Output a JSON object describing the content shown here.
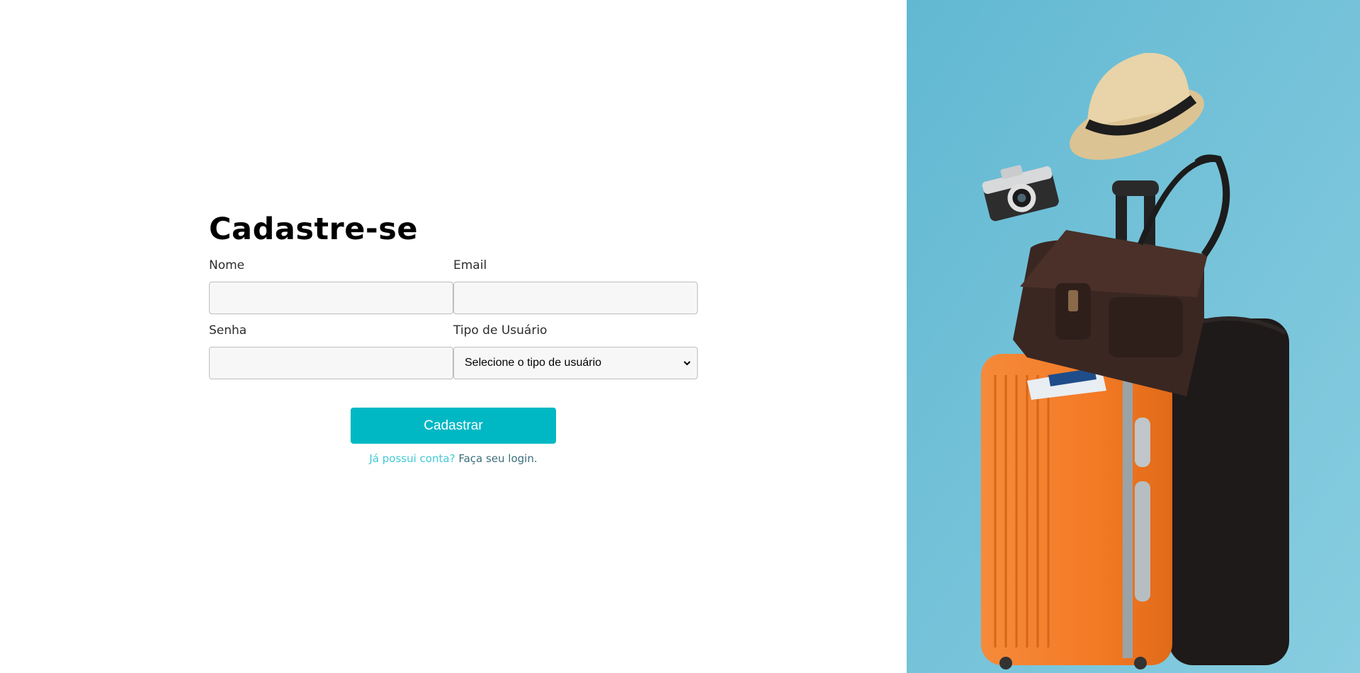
{
  "form": {
    "title": "Cadastre-se",
    "fields": {
      "name_label": "Nome",
      "email_label": "Email",
      "password_label": "Senha",
      "user_type_label": "Tipo de Usuário",
      "name_value": "",
      "email_value": "",
      "password_value": "",
      "user_type_selected": "Selecione o tipo de usuário"
    },
    "submit_label": "Cadastrar",
    "login_prompt": "Já possui conta?",
    "login_link": "Faça seu login."
  },
  "colors": {
    "accent": "#00b8c4",
    "link": "#41c9d5",
    "link_dark": "#3b6e7c",
    "photo_background": "#6fc2d8",
    "suitcase": "#f57c2a"
  }
}
